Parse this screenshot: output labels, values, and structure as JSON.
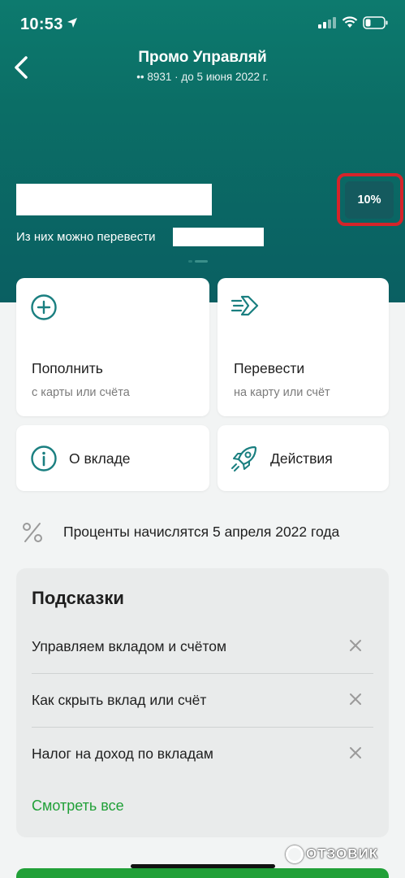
{
  "status": {
    "time": "10:53"
  },
  "header": {
    "title": "Промо Управляй",
    "subtitle": "•• 8931 · до 5 июня 2022 г."
  },
  "balance": {
    "transfer_label": "Из них можно перевести",
    "rate": "10%"
  },
  "actions": {
    "top_up": {
      "label": "Пополнить",
      "sub": "с карты или счёта"
    },
    "transfer": {
      "label": "Перевести",
      "sub": "на карту или счёт"
    },
    "about": {
      "label": "О вкладе"
    },
    "operations": {
      "label": "Действия"
    }
  },
  "interest": {
    "text": "Проценты начислятся 5 апреля 2022 года"
  },
  "hints": {
    "title": "Подсказки",
    "items": [
      {
        "label": "Управляем вкладом и счётом"
      },
      {
        "label": "Как скрыть вклад или счёт"
      },
      {
        "label": "Налог на доход по вкладам"
      }
    ],
    "see_all": "Смотреть все"
  },
  "watermark": "ОТЗОВИК",
  "colors": {
    "header_bg": "#0b6e66",
    "accent_green": "#21a038",
    "highlight_red": "#d4242a",
    "icon_teal": "#1a7f80"
  },
  "icons": [
    "back-arrow-icon",
    "plus-circle-icon",
    "send-arrow-icon",
    "info-icon",
    "rocket-icon",
    "percent-icon",
    "close-icon"
  ]
}
